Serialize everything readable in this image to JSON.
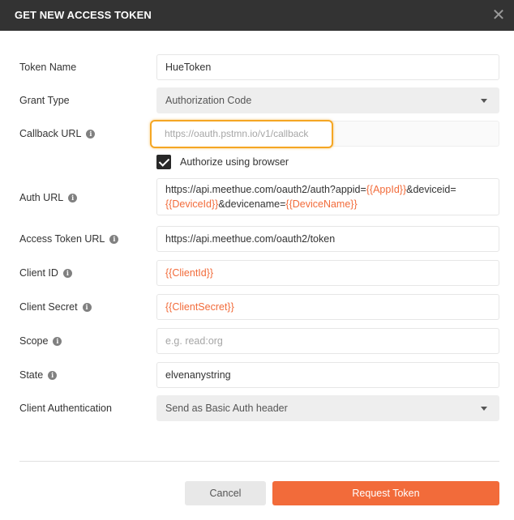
{
  "dialog": {
    "title": "GET NEW ACCESS TOKEN",
    "close_glyph": "✕"
  },
  "labels": {
    "token_name": "Token Name",
    "grant_type": "Grant Type",
    "callback_url": "Callback URL",
    "auth_url": "Auth URL",
    "access_token_url": "Access Token URL",
    "client_id": "Client ID",
    "client_secret": "Client Secret",
    "scope": "Scope",
    "state": "State",
    "client_authentication": "Client Authentication"
  },
  "info_glyph": "i",
  "fields": {
    "token_name": "HueToken",
    "grant_type": "Authorization Code",
    "callback_url_placeholder": "https://oauth.pstmn.io/v1/callback",
    "authorize_using_browser": "Authorize using browser",
    "auth_url": {
      "p1": "https://api.meethue.com/oauth2/auth?appid=",
      "v1": "{{AppId}}",
      "p2": "&deviceid=",
      "v2": "{{DeviceId}}",
      "p3": "&devicename=",
      "v3": "{{DeviceName}}"
    },
    "access_token_url": "https://api.meethue.com/oauth2/token",
    "client_id": "{{ClientId}}",
    "client_secret": "{{ClientSecret}}",
    "scope_placeholder": "e.g. read:org",
    "state": "elvenanystring",
    "client_authentication": "Send as Basic Auth header"
  },
  "buttons": {
    "cancel": "Cancel",
    "request_token": "Request Token"
  },
  "colors": {
    "accent": "#f26b3a",
    "highlight": "#f5a623",
    "titlebar": "#333333"
  }
}
